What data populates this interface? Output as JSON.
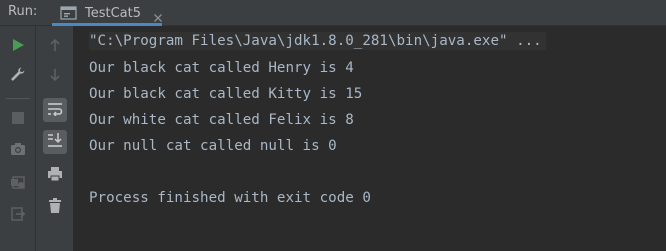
{
  "header": {
    "run_label": "Run:",
    "tab_label": "TestCat5"
  },
  "toolbar": {
    "left": [
      "rerun-icon",
      "settings-wrench-icon",
      "stop-icon",
      "camera-icon",
      "restore-layout-icon",
      "exit-icon"
    ],
    "right": [
      "up-arrow-icon",
      "down-arrow-icon",
      "soft-wrap-icon",
      "scroll-to-end-icon",
      "print-icon",
      "trash-icon"
    ]
  },
  "console": {
    "command_line": "\"C:\\Program Files\\Java\\jdk1.8.0_281\\bin\\java.exe\" ...",
    "output": [
      "Our black cat called Henry is 4",
      "Our black cat called Kitty is 15",
      "Our white cat called Felix is 8",
      "Our null cat called null is 0"
    ],
    "exit_message": "Process finished with exit code 0"
  },
  "colors": {
    "background": "#2b2b2b",
    "panel": "#3c3f41",
    "text": "#a9b7c6",
    "run_green": "#499c54",
    "tab_underline": "#4a88c7"
  }
}
